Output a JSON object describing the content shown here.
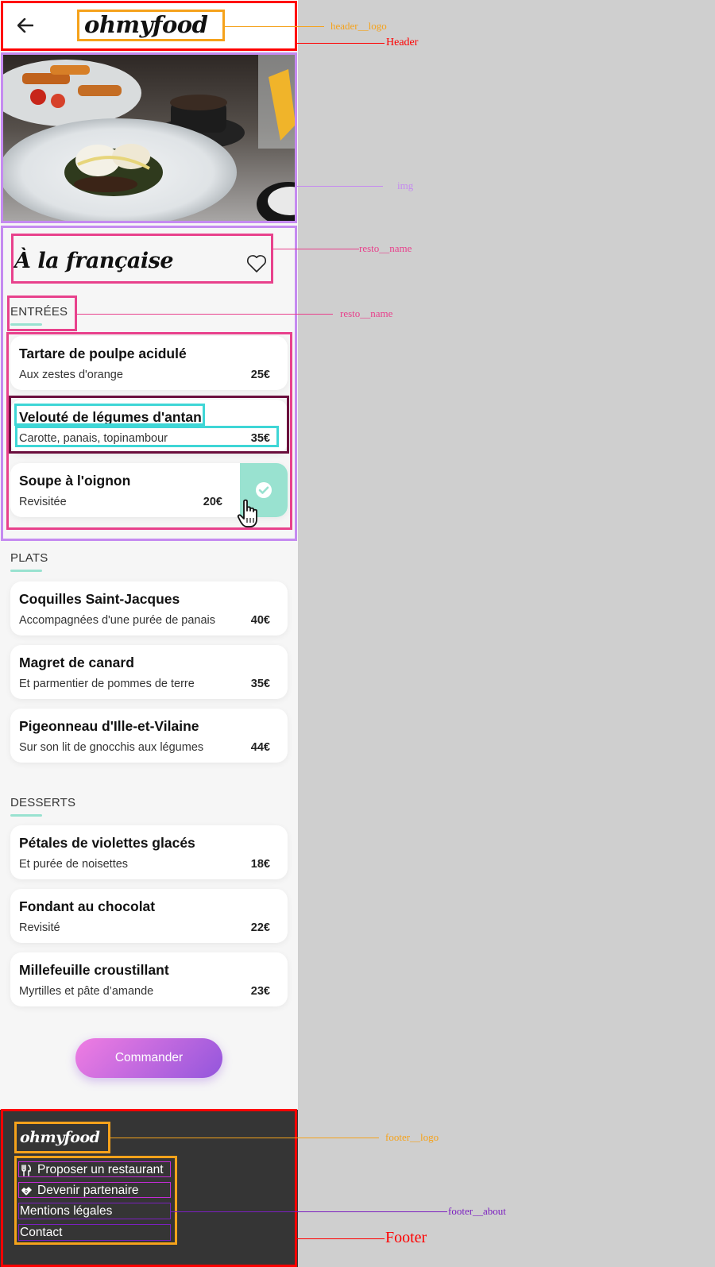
{
  "header": {
    "logo": "ohmyfood"
  },
  "hero": {
    "alt": "Plats servis au restaurant"
  },
  "restaurant": {
    "name": "À la française"
  },
  "sections": [
    {
      "title": "ENTRÉES",
      "dishes": [
        {
          "name": "Tartare de poulpe acidulé",
          "desc": "Aux zestes d'orange",
          "price": "25€"
        },
        {
          "name": "Velouté de légumes d'antan",
          "desc": "Carotte, panais, topinambour",
          "price": "35€"
        },
        {
          "name": "Soupe à l'oignon",
          "desc": "Revisitée",
          "price": "20€",
          "selected": true
        }
      ]
    },
    {
      "title": "PLATS",
      "dishes": [
        {
          "name": "Coquilles Saint-Jacques",
          "desc": "Accompagnées d'une purée de panais",
          "price": "40€"
        },
        {
          "name": "Magret de canard",
          "desc": "Et parmentier de pommes de terre",
          "price": "35€"
        },
        {
          "name": "Pigeonneau d'Ille-et-Vilaine",
          "desc": "Sur son lit de gnocchis aux légumes",
          "price": "44€"
        }
      ]
    },
    {
      "title": "DESSERTS",
      "dishes": [
        {
          "name": "Pétales de violettes glacés",
          "desc": "Et purée de noisettes",
          "price": "18€"
        },
        {
          "name": "Fondant au chocolat",
          "desc": "Revisité",
          "price": "22€"
        },
        {
          "name": "Millefeuille croustillant",
          "desc": "Myrtilles et pâte d’amande",
          "price": "23€"
        }
      ]
    }
  ],
  "order_button": "Commander",
  "footer": {
    "logo": "ohmyfood",
    "links": [
      {
        "label": "Proposer un restaurant",
        "icon": "utensils-icon"
      },
      {
        "label": "Devenir partenaire",
        "icon": "handshake-icon"
      },
      {
        "label": "Mentions légales",
        "icon": ""
      },
      {
        "label": "Contact",
        "icon": ""
      }
    ]
  },
  "annotations": {
    "header_logo": "header__logo",
    "header": "Header",
    "img": "img",
    "resto_name": "resto__name",
    "resto_name_2": "resto__name",
    "footer_logo": "footer__logo",
    "footer_about": "footer__about",
    "footer": "Footer"
  },
  "colors": {
    "accent_mint": "#99e2d0",
    "button_pink": "#f07de2",
    "button_purple": "#9356dc",
    "footer_bg": "#353535",
    "annotation_red": "#ff0000",
    "annotation_orange": "#f5a21b",
    "annotation_lilac": "#c58af0",
    "annotation_pink": "#e8418c",
    "annotation_cyan": "#3fd6d6",
    "annotation_maroon": "#6b0e3d",
    "annotation_purple": "#7b1fbf"
  }
}
